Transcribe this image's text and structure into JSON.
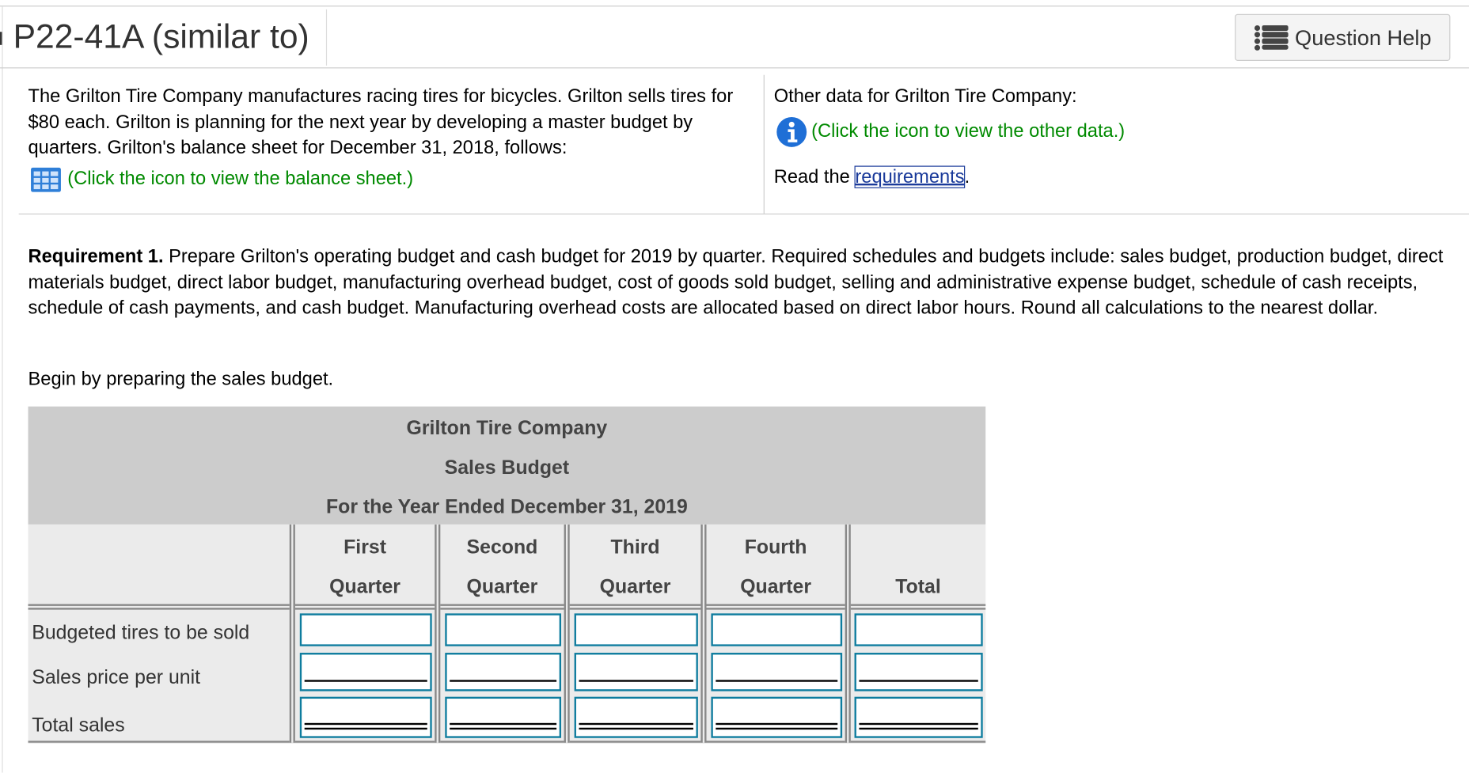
{
  "header": {
    "title": "P22-41A (similar to)",
    "help_label": "Question Help",
    "help_icon": "list-icon"
  },
  "intro": {
    "text": "The Grilton Tire Company manufactures racing tires for bicycles. Grilton sells tires for $80 each. Grilton is planning for the next year by developing a master budget by quarters. Grilton's balance sheet for December 31, 2018, follows:",
    "balance_link": "(Click the icon to view the balance sheet.)",
    "balance_icon": "table-grid-icon"
  },
  "other": {
    "label": "Other data for Grilton Tire Company:",
    "data_link": "(Click the icon to view the other data.)",
    "data_icon": "info-icon",
    "read_prefix": "Read the ",
    "requirements_link": "requirements",
    "read_suffix": "."
  },
  "requirement": {
    "bold": "Requirement 1.",
    "text": " Prepare Grilton's operating budget and cash budget for 2019 by quarter. Required schedules and budgets include: sales budget, production budget, direct materials budget, direct labor budget, manufacturing overhead budget, cost of goods sold budget, selling and administrative expense budget, schedule of cash receipts, schedule of cash payments, and cash budget. Manufacturing overhead costs are allocated based on direct labor hours. Round all calculations to the nearest dollar.",
    "begin": "Begin by preparing the sales budget."
  },
  "table": {
    "company": "Grilton Tire Company",
    "name": "Sales Budget",
    "period": "For the Year Ended December 31, 2019",
    "columns": [
      {
        "top": "First",
        "bottom": "Quarter"
      },
      {
        "top": "Second",
        "bottom": "Quarter"
      },
      {
        "top": "Third",
        "bottom": "Quarter"
      },
      {
        "top": "Fourth",
        "bottom": "Quarter"
      },
      {
        "top": "",
        "bottom": "Total"
      }
    ],
    "rows": [
      {
        "label": "Budgeted tires to be sold",
        "values": [
          "",
          "",
          "",
          "",
          ""
        ]
      },
      {
        "label": "Sales price per unit",
        "values": [
          "",
          "",
          "",
          "",
          ""
        ]
      },
      {
        "label": "Total sales",
        "values": [
          "",
          "",
          "",
          "",
          ""
        ]
      }
    ]
  },
  "colors": {
    "link_green": "#008a00",
    "input_border": "#0e7c9e",
    "header_gray": "#cccccc"
  }
}
